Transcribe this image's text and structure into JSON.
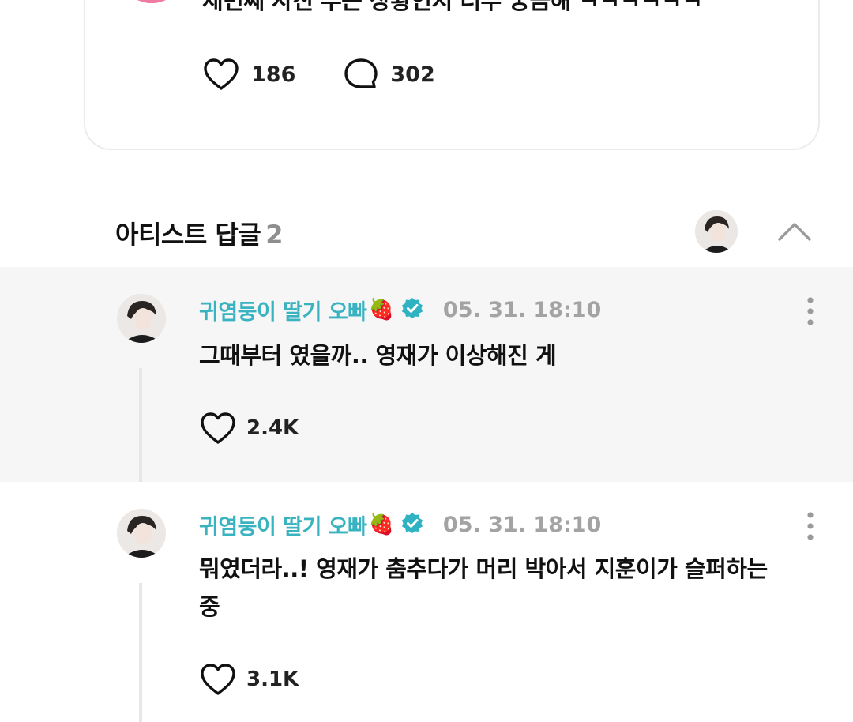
{
  "post": {
    "text": "세번째 사진 무슨 상황인지 너무 궁금해 ㅋㅋㅋㅋㅋㅋ",
    "likes": "186",
    "comments": "302"
  },
  "artist_replies": {
    "title": "아티스트 답글",
    "count": "2"
  },
  "replies": [
    {
      "author": "귀염둥이 딸기 오빠",
      "author_emoji": "🍓",
      "time": "05. 31. 18:10",
      "text": "그때부터 였을까.. 영재가 이상해진 게",
      "likes": "2.4K"
    },
    {
      "author": "귀염둥이 딸기 오빠",
      "author_emoji": "🍓",
      "time": "05. 31. 18:10",
      "text": "뭐였더라..! 영재가 춤추다가 머리 박아서 지훈이가 슬퍼하는 중",
      "likes": "3.1K"
    }
  ],
  "colors": {
    "accent_name": "#3ab3c0",
    "verified_badge": "#2fb3c3",
    "muted": "#a3a3a3",
    "highlight_bg": "#f6f6f7"
  },
  "icons": {
    "like": "heart-outline-icon",
    "comment": "speech-bubble-icon",
    "verified": "verified-badge-icon",
    "collapse": "chevron-up-icon",
    "more": "vertical-dots-icon"
  }
}
